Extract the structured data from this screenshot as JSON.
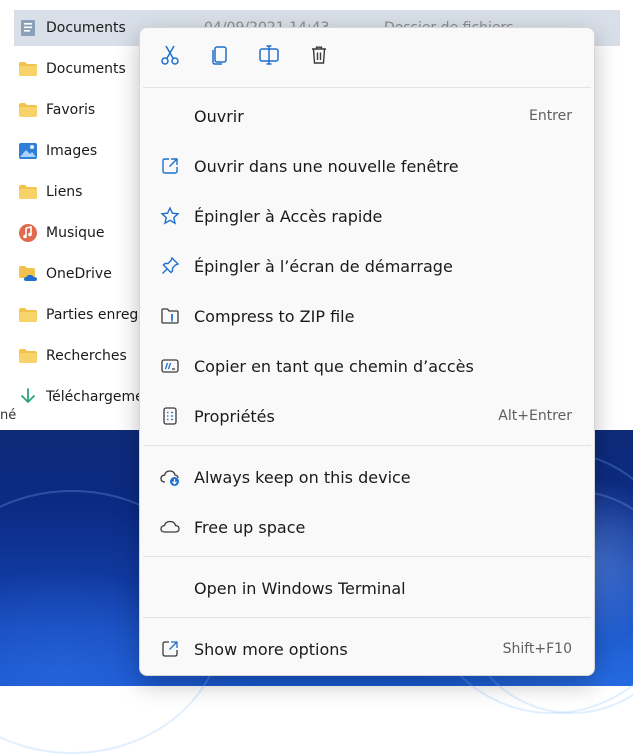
{
  "explorer": {
    "rows": [
      {
        "name": "Documents",
        "icon": "document-library-icon",
        "date": "04/09/2021 14:43",
        "type": "Dossier de fichiers",
        "selected": true
      },
      {
        "name": "Documents",
        "icon": "folder-icon"
      },
      {
        "name": "Favoris",
        "icon": "folder-icon"
      },
      {
        "name": "Images",
        "icon": "images-icon"
      },
      {
        "name": "Liens",
        "icon": "folder-icon"
      },
      {
        "name": "Musique",
        "icon": "music-icon"
      },
      {
        "name": "OneDrive",
        "icon": "onedrive-folder-icon"
      },
      {
        "name": "Parties enregistrées",
        "icon": "folder-icon"
      },
      {
        "name": "Recherches",
        "icon": "folder-icon"
      },
      {
        "name": "Téléchargements",
        "icon": "download-icon"
      }
    ],
    "status": "né"
  },
  "menu": {
    "toolbar": [
      {
        "name": "cut-icon"
      },
      {
        "name": "copy-icon"
      },
      {
        "name": "rename-icon"
      },
      {
        "name": "delete-icon"
      }
    ],
    "items": [
      {
        "label": "Ouvrir",
        "shortcut": "Entrer",
        "icon": ""
      },
      {
        "label": "Ouvrir dans une nouvelle fenêtre",
        "shortcut": "",
        "icon": "open-new-window-icon"
      },
      {
        "label": "Épingler à Accès rapide",
        "shortcut": "",
        "icon": "star-icon"
      },
      {
        "label": "Épingler à l’écran de démarrage",
        "shortcut": "",
        "icon": "pin-icon"
      },
      {
        "label": "Compress to ZIP file",
        "shortcut": "",
        "icon": "zip-folder-icon"
      },
      {
        "label": "Copier en tant que chemin d’accès",
        "shortcut": "",
        "icon": "copy-path-icon"
      },
      {
        "label": "Propriétés",
        "shortcut": "Alt+Entrer",
        "icon": "properties-icon"
      },
      {
        "label": "Always keep on this device",
        "shortcut": "",
        "icon": "cloud-download-icon"
      },
      {
        "label": "Free up space",
        "shortcut": "",
        "icon": "cloud-icon"
      },
      {
        "label": "Open in Windows Terminal",
        "shortcut": "",
        "icon": ""
      },
      {
        "label": "Show more options",
        "shortcut": "Shift+F10",
        "icon": "more-options-icon"
      }
    ]
  },
  "colors": {
    "accent": "#1f6fd0",
    "selection": "#d8dfe8",
    "folder": "#f2c14e"
  }
}
